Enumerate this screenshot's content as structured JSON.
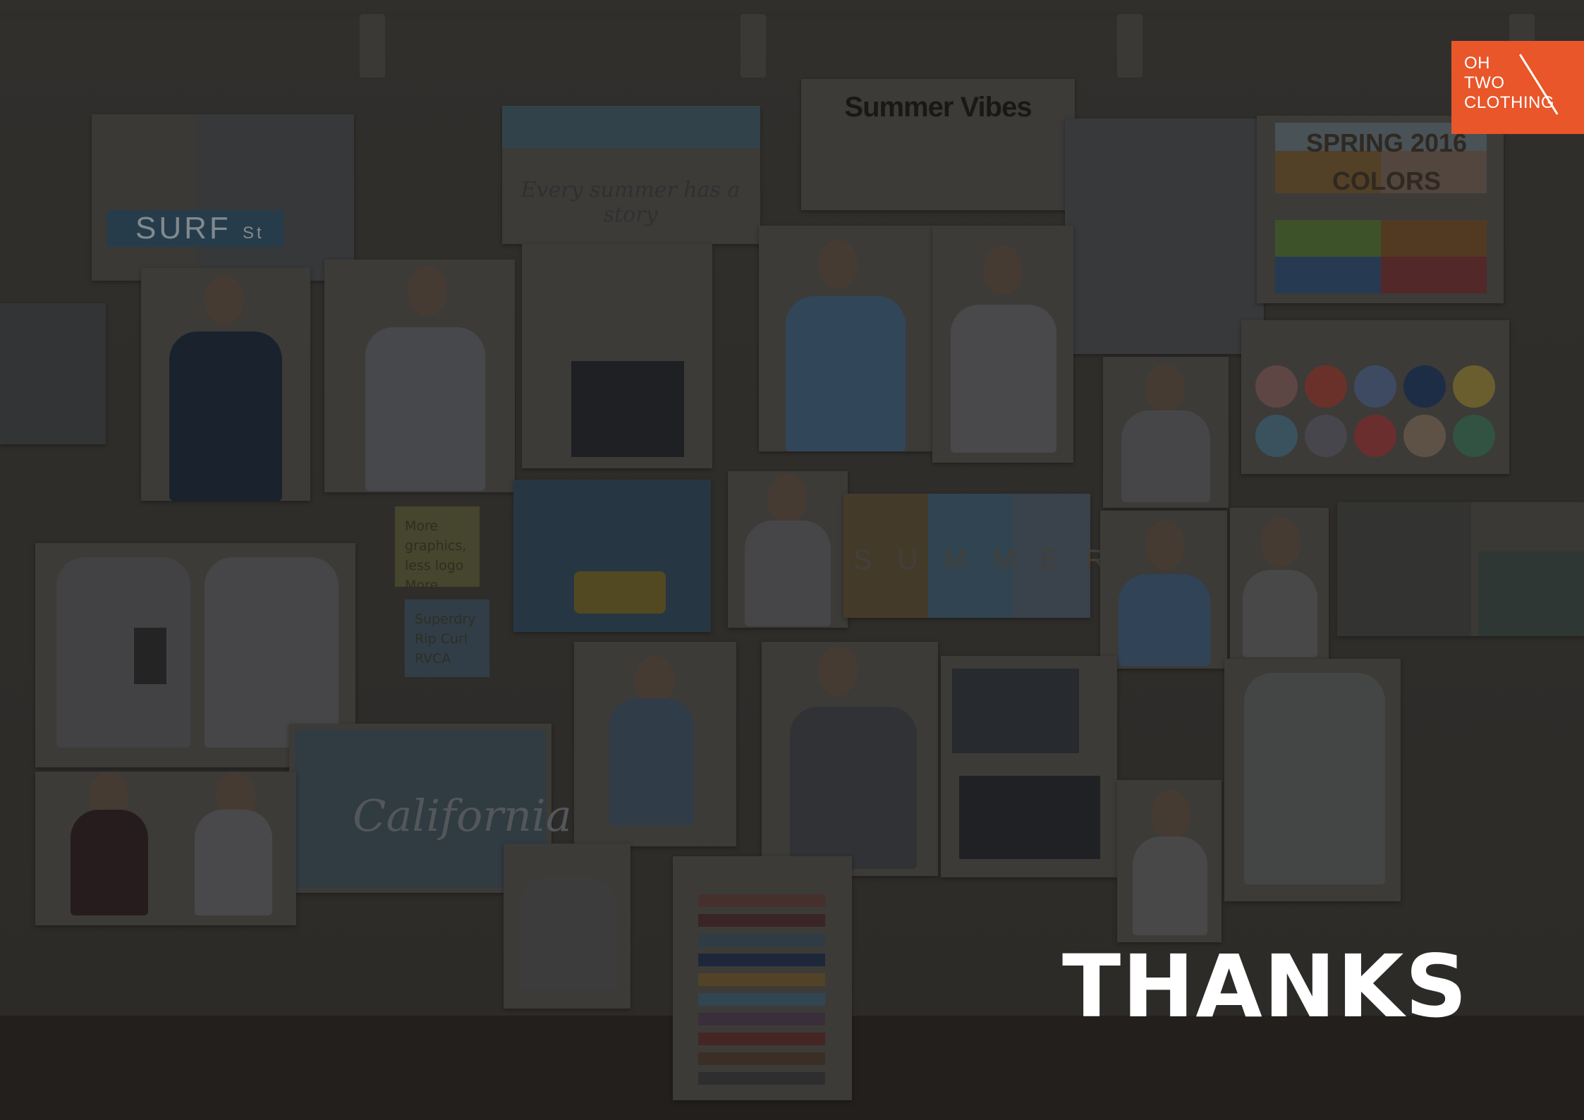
{
  "slide": {
    "title": "THANKS",
    "background": "mood board photo of summer apparel, dimmed",
    "accent_color": "#e8562a"
  },
  "logo": {
    "line1": "OH",
    "line2": "TWO",
    "line3": "CLOTHING",
    "background": "#e8562a",
    "text_color": "#ffffff"
  },
  "moodboard": {
    "header_card": "Summer Vibes",
    "beach_caption": "Every summer has a story",
    "street_sign": "SURF",
    "street_sign_suffix": "St",
    "palette_card_title_line1": "SPRING 2016",
    "palette_card_title_line2": "COLORS",
    "sticky_note_1_line1": "More graphics,",
    "sticky_note_1_line2": "less logo",
    "sticky_note_1_line3": "More brands",
    "sticky_note_2_line1": "Superdry",
    "sticky_note_2_line2": "Rip Curl",
    "sticky_note_2_line3": "RVCA",
    "california_print": "California",
    "summer_strip": "SUMMER",
    "palette_colors": [
      "#4c5f6f",
      "#6a3b32",
      "#7a6a3d",
      "#2f4a6a",
      "#8b5a3a",
      "#4a6a60",
      "#7a4a55",
      "#5a5f3a"
    ],
    "color_dots": [
      "#7a5a58",
      "#8a3e36",
      "#4f5f7f",
      "#25385a",
      "#8a7a3a",
      "#4a6a7a",
      "#5a5a62",
      "#8a3a3a",
      "#7a6a5a",
      "#3f6a55"
    ]
  }
}
